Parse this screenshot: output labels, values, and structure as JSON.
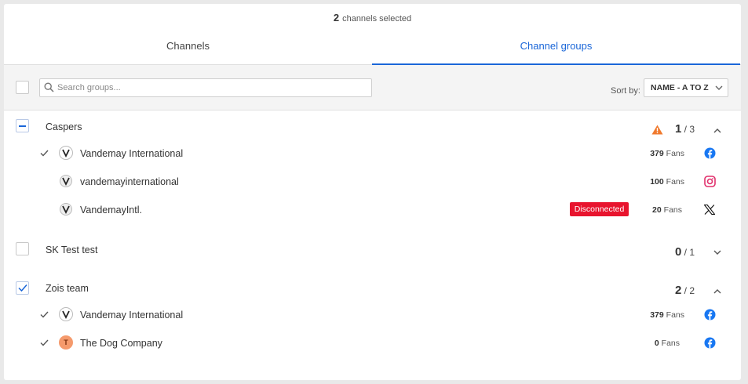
{
  "header": {
    "selected_count": "2",
    "selected_suffix": "channels selected"
  },
  "tabs": [
    {
      "label": "Channels",
      "active": false
    },
    {
      "label": "Channel groups",
      "active": true
    }
  ],
  "toolbar": {
    "search_placeholder": "Search groups...",
    "sort_label": "Sort by:",
    "sort_value": "NAME - A TO Z"
  },
  "colors": {
    "accent": "#1a66d8",
    "warning": "#f07a2e",
    "disconnected": "#e8142e",
    "facebook": "#1877f2",
    "instagram": "#e1306c"
  },
  "groups": [
    {
      "name": "Caspers",
      "selected": "1",
      "total": "3",
      "state": "partial",
      "expanded": true,
      "warning": true,
      "channels": [
        {
          "name": "Vandemay International",
          "fans": "379",
          "fans_label": "Fans",
          "network": "facebook-icon",
          "checked": true
        },
        {
          "name": "vandemayinternational",
          "fans": "100",
          "fans_label": "Fans",
          "network": "instagram-icon",
          "checked": false
        },
        {
          "name": "VandemayIntl.",
          "fans": "20",
          "fans_label": "Fans",
          "network": "x-icon",
          "checked": false,
          "status": "Disconnected"
        }
      ]
    },
    {
      "name": "SK Test test",
      "selected": "0",
      "total": "1",
      "state": "unchecked",
      "expanded": false,
      "warning": false,
      "channels": []
    },
    {
      "name": "Zois team",
      "selected": "2",
      "total": "2",
      "state": "checked",
      "expanded": true,
      "warning": false,
      "channels": [
        {
          "name": "Vandemay International",
          "fans": "379",
          "fans_label": "Fans",
          "network": "facebook-icon",
          "checked": true
        },
        {
          "name": "The Dog Company",
          "fans": "0",
          "fans_label": "Fans",
          "network": "facebook-icon",
          "checked": true,
          "avatar_letter": "T"
        }
      ]
    }
  ]
}
